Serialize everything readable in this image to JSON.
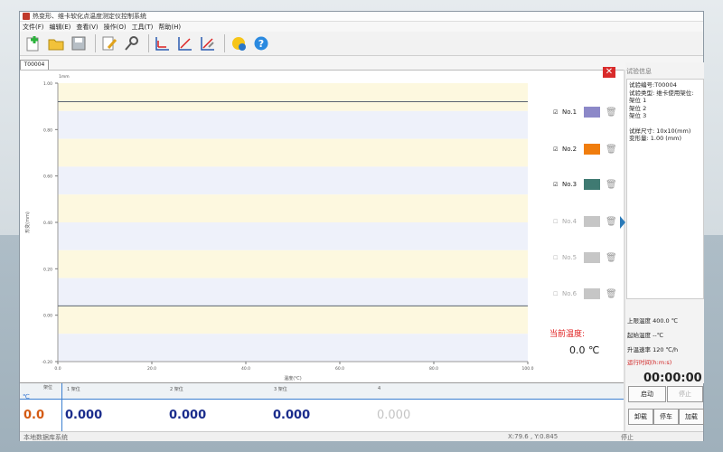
{
  "window": {
    "title": "热变形、维卡软化点温度测定仪控制系统"
  },
  "menu": [
    "文件(F)",
    "编辑(E)",
    "查看(V)",
    "操作(O)",
    "工具(T)",
    "帮助(H)"
  ],
  "toolbar_icons": [
    "new-icon",
    "open-folder-icon",
    "save-icon",
    "edit-icon",
    "search-icon",
    "chart-line-icon",
    "chart-curve-icon",
    "chart-edit-icon",
    "badge-icon",
    "help-icon"
  ],
  "tab": {
    "label": "T00004"
  },
  "chart_data": {
    "type": "line",
    "title": "",
    "corner_label": "1mm",
    "xlabel": "温度(℃)",
    "ylabel": "形变(mm)",
    "xlim": [
      0,
      100
    ],
    "ylim": [
      -0.2,
      1.0
    ],
    "x_ticks": [
      "0.0",
      "20.0",
      "40.0",
      "60.0",
      "80.0",
      "100.0"
    ],
    "y_ticks": [
      "1.00",
      "0.80",
      "0.60",
      "0.40",
      "0.20",
      "0.00",
      "-0.20"
    ],
    "series": [],
    "reference_lines": [
      0.92,
      0.04
    ],
    "grid": "alternating bands"
  },
  "legend": [
    {
      "label": "No.1",
      "checked": "☑",
      "color": "#8c88c8",
      "enabled": true
    },
    {
      "label": "No.2",
      "checked": "☑",
      "color": "#f07d0d",
      "enabled": true
    },
    {
      "label": "No.3",
      "checked": "☑",
      "color": "#3f7a72",
      "enabled": true
    },
    {
      "label": "No.4",
      "checked": "☐",
      "color": "#c6c6c6",
      "enabled": false
    },
    {
      "label": "No.5",
      "checked": "☐",
      "color": "#c6c6c6",
      "enabled": false
    },
    {
      "label": "No.6",
      "checked": "☐",
      "color": "#c6c6c6",
      "enabled": false
    }
  ],
  "current_temp": {
    "label": "当前温度:",
    "value": "0.0 ℃"
  },
  "info": {
    "title": "试验信息",
    "lines": [
      "试验编号:T00004",
      "试验类型: 维卡使用架位:",
      "架位 1",
      "架位 2",
      "架位 3",
      "",
      "试样尺寸: 10x10(mm)",
      "变形量: 1.00 (mm)"
    ]
  },
  "stats": {
    "upper_temp": "上限温度  400.0 ℃",
    "start_temp": "起始温度  --℃",
    "rate": "升温速率  120 ℃/h",
    "run_time_label": "运行时间(h:m:s)",
    "run_time": "00:00:00"
  },
  "bottom_table": {
    "corner_label": "℃",
    "corner_sub": "架位",
    "temp": "0.0",
    "columns": [
      {
        "header": "1 架位",
        "value": "0.000",
        "active": true
      },
      {
        "header": "2 架位",
        "value": "0.000",
        "active": true
      },
      {
        "header": "3 架位",
        "value": "0.000",
        "active": true
      },
      {
        "header": "4",
        "value": "0.000",
        "active": false
      }
    ]
  },
  "buttons": {
    "start": "启动",
    "stop": "停止",
    "unload": "卸载",
    "pause": "停车",
    "load": "加载"
  },
  "status": {
    "left": "本地数据库系统",
    "coords": "X:79.6 , Y:0.845",
    "state": "停止"
  }
}
